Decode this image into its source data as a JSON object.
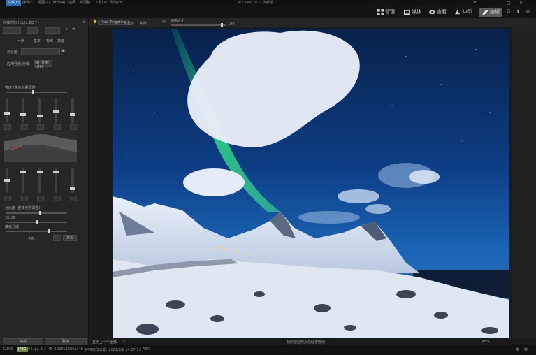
{
  "app": {
    "title": "ACDSee 2022 旗舰版"
  },
  "menu": {
    "items": [
      "文件(F)",
      "编辑(E)",
      "视图(V)",
      "修饰(A)",
      "选择",
      "批调整",
      "工具(T)",
      "帮助(H)"
    ]
  },
  "modes": [
    {
      "label": "管理",
      "icon": "grid-icon"
    },
    {
      "label": "媒体",
      "icon": "media-icon"
    },
    {
      "label": "查看",
      "icon": "eye-icon"
    },
    {
      "label": "冲印",
      "icon": "develop-icon"
    },
    {
      "label": "编辑",
      "icon": "edit-icon"
    }
  ],
  "left_panel": {
    "preset_title": "光线均衡 (Light EQ™)",
    "tabs": [
      "一步",
      "基本",
      "标准",
      "高级"
    ],
    "preset_label": "预设值:",
    "strength_label": "应用强度/光线:",
    "strength_value": "50 (0 到 100)",
    "section_brightness": "亮度 (整体光照调整)",
    "section_contrast": "对比度 (整体光照调整)",
    "label_a": "对比度",
    "label_b": "填充光线",
    "label_c": "色阶:",
    "toggle_label": "复位",
    "reset_button": "完成",
    "done_button": "取消"
  },
  "viewer": {
    "tab_label": "Pixel Targeting",
    "zoom_label": "显示",
    "zoom_value": "实际",
    "filter_label": "画面大小",
    "slider_value": "100",
    "bottom_left": "显示上一个图像",
    "bottom_mid": "我的原始照片已经被修改",
    "zoom_percent": "46%"
  },
  "status": {
    "count": "6/106",
    "format": "JPEG",
    "filename": "04.jpg",
    "size": "1.4 MB",
    "dimensions": "1920x1280x24b jpeg",
    "modified": "修改日期: 2021/9/8 14:07:13",
    "zoom": "46%"
  },
  "colors": {
    "accent": "#2a6fb3",
    "panel": "#262626",
    "sky_top": "#0b2a5c",
    "aurora": "#2ec27e"
  }
}
